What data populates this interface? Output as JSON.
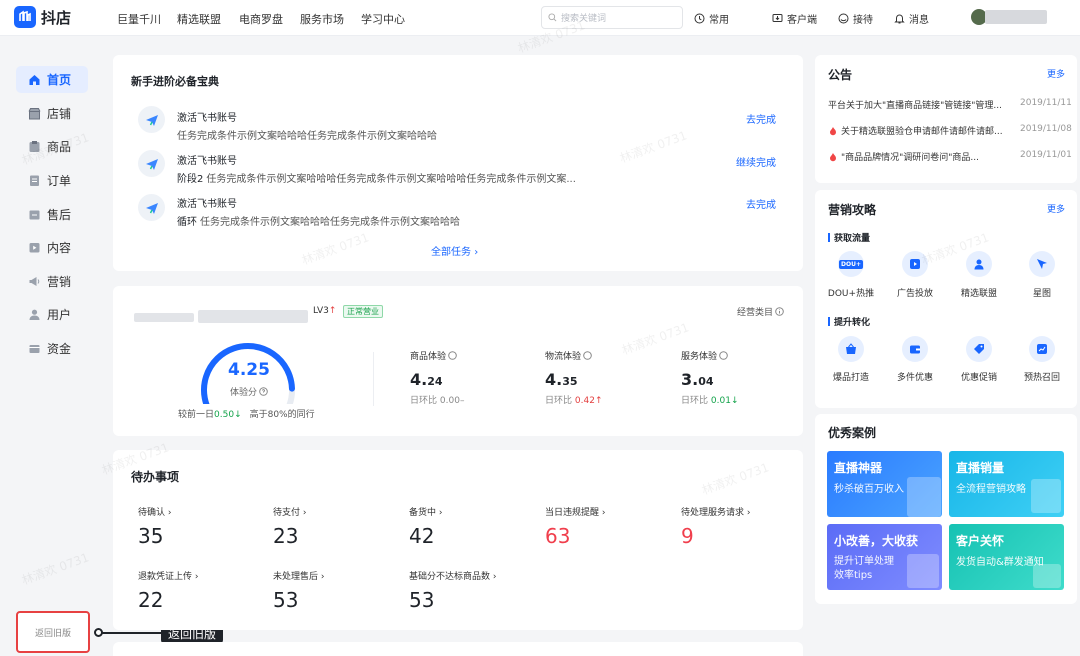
{
  "topbar": {
    "logo_text": "抖店",
    "nav": [
      "巨量千川",
      "精选联盟",
      "电商罗盘",
      "服务市场",
      "学习中心"
    ],
    "search_placeholder": "搜索关键词",
    "tools": {
      "common": "常用",
      "client": "客户端",
      "reception": "接待",
      "message": "消息"
    }
  },
  "sidebar": {
    "items": [
      {
        "label": "首页",
        "icon": "home-icon",
        "active": true
      },
      {
        "label": "店铺",
        "icon": "store-icon"
      },
      {
        "label": "商品",
        "icon": "product-icon"
      },
      {
        "label": "订单",
        "icon": "order-icon"
      },
      {
        "label": "售后",
        "icon": "aftersale-icon"
      },
      {
        "label": "内容",
        "icon": "content-icon"
      },
      {
        "label": "营销",
        "icon": "marketing-icon"
      },
      {
        "label": "用户",
        "icon": "user-icon"
      },
      {
        "label": "资金",
        "icon": "wallet-icon"
      }
    ],
    "old_version": "返回旧版",
    "callout": "返回旧版"
  },
  "guide": {
    "title": "新手进阶必备宝典",
    "tasks": [
      {
        "title": "激活飞书账号",
        "prefix": "",
        "desc": "任务完成条件示例文案哈哈哈任务完成条件示例文案哈哈哈",
        "action": "去完成"
      },
      {
        "title": "激活飞书账号",
        "prefix": "阶段2",
        "desc": "任务完成条件示例文案哈哈哈任务完成条件示例文案哈哈哈任务完成条件示例文案...",
        "action": "继续完成"
      },
      {
        "title": "激活飞书账号",
        "prefix": "循环",
        "desc": "任务完成条件示例文案哈哈哈任务完成条件示例文案哈哈哈",
        "action": "去完成"
      }
    ],
    "all_tasks": "全部任务"
  },
  "shop": {
    "level": "LV3",
    "status": "正常营业",
    "category_link": "经营类目",
    "score": "4.25",
    "score_label": "体验分",
    "score_fraction": 0.85,
    "compare_prefix": "较前一日",
    "compare_value": "0.50",
    "peer_text": "高于80%的同行",
    "metrics": [
      {
        "label": "商品体验",
        "big": "4.",
        "small": "24",
        "sub_label": "日环比",
        "sub_value": "0.00",
        "trend": "flat"
      },
      {
        "label": "物流体验",
        "big": "4.",
        "small": "35",
        "sub_label": "日环比",
        "sub_value": "0.42",
        "trend": "up"
      },
      {
        "label": "服务体验",
        "big": "3.",
        "small": "04",
        "sub_label": "日环比",
        "sub_value": "0.01",
        "trend": "down"
      }
    ]
  },
  "todo": {
    "title": "待办事项",
    "items": [
      {
        "label": "待确认",
        "value": "35",
        "alert": false
      },
      {
        "label": "待支付",
        "value": "23",
        "alert": false
      },
      {
        "label": "备货中",
        "value": "42",
        "alert": false
      },
      {
        "label": "当日违规提醒",
        "value": "63",
        "alert": true
      },
      {
        "label": "待处理服务请求",
        "value": "9",
        "alert": true
      },
      {
        "label": "退款凭证上传",
        "value": "22",
        "alert": false
      },
      {
        "label": "未处理售后",
        "value": "53",
        "alert": false
      },
      {
        "label": "基础分不达标商品数",
        "value": "53",
        "alert": false
      }
    ]
  },
  "announcement": {
    "title": "公告",
    "more": "更多",
    "rows": [
      {
        "text": "平台关于加大\"直播商品链接\"管链接\"管理...",
        "date": "2019/11/11",
        "hot": false
      },
      {
        "text": "关于精选联盟验仓申请邮件请邮件请邮...",
        "date": "2019/11/08",
        "hot": true
      },
      {
        "text": "\"商品品牌情况\"调研问卷问\"商品...",
        "date": "2019/11/01",
        "hot": true
      }
    ]
  },
  "marketing": {
    "title": "营销攻略",
    "more": "更多",
    "section1": "获取流量",
    "section2": "提升转化",
    "row1": [
      {
        "label": "DOU+热推",
        "icon": "dou-icon",
        "badge": "DOU+"
      },
      {
        "label": "广告投放",
        "icon": "ad-icon"
      },
      {
        "label": "精选联盟",
        "icon": "alliance-icon"
      },
      {
        "label": "星图",
        "icon": "star-map-icon"
      }
    ],
    "row2": [
      {
        "label": "爆品打造",
        "icon": "hot-product-icon"
      },
      {
        "label": "多件优惠",
        "icon": "multi-discount-icon"
      },
      {
        "label": "优惠促销",
        "icon": "promotion-icon"
      },
      {
        "label": "预热召回",
        "icon": "recall-icon"
      }
    ]
  },
  "cases": {
    "title": "优秀案例",
    "items": [
      {
        "title": "直播神器",
        "sub": "秒杀破百万收入",
        "sub2": ""
      },
      {
        "title": "直播销量",
        "sub": "全流程营销攻略",
        "sub2": ""
      },
      {
        "title": "小改善，大收获",
        "sub": "提升订单处理",
        "sub2": "效率tips"
      },
      {
        "title": "客户关怀",
        "sub": "发货自动&群发通知",
        "sub2": ""
      }
    ]
  },
  "watermark": "林清欢 0731",
  "colors": {
    "brand": "#1966ff",
    "alert": "#f03e4c",
    "success": "#14a34b",
    "callout_border": "#e74142"
  }
}
